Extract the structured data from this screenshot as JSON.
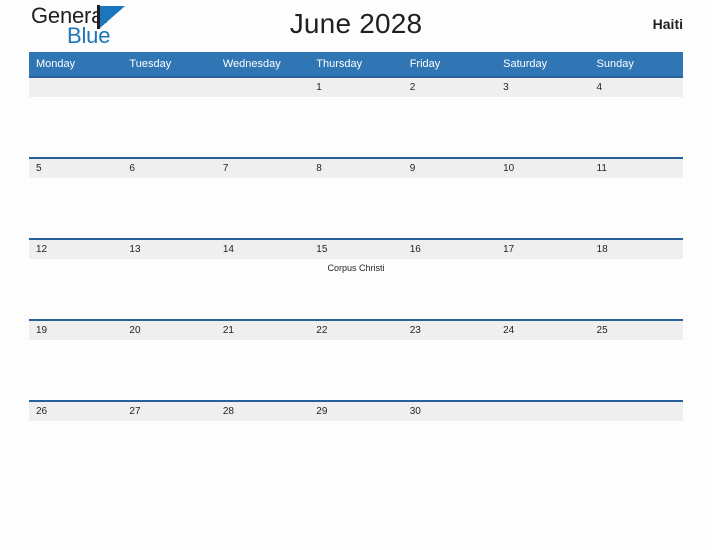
{
  "brand": {
    "name_part1": "General",
    "name_part2": "Blue",
    "mark": "triangle-logo-icon"
  },
  "header": {
    "title": "June 2028",
    "country": "Haiti"
  },
  "colors": {
    "header_blue": "#3075b4",
    "week_divider_blue": "#2a6099",
    "date_band_gray": "#efefef",
    "brand_blue": "#1b76bb",
    "text_dark": "#231f20",
    "page_background": "#fdfdfd"
  },
  "calendar": {
    "month": "June",
    "year": "2028",
    "weekday_headers": [
      "Monday",
      "Tuesday",
      "Wednesday",
      "Thursday",
      "Friday",
      "Saturday",
      "Sunday"
    ],
    "weeks": [
      {
        "days": [
          {
            "num": "",
            "events": []
          },
          {
            "num": "",
            "events": []
          },
          {
            "num": "",
            "events": []
          },
          {
            "num": "1",
            "events": []
          },
          {
            "num": "2",
            "events": []
          },
          {
            "num": "3",
            "events": []
          },
          {
            "num": "4",
            "events": []
          }
        ]
      },
      {
        "days": [
          {
            "num": "5",
            "events": []
          },
          {
            "num": "6",
            "events": []
          },
          {
            "num": "7",
            "events": []
          },
          {
            "num": "8",
            "events": []
          },
          {
            "num": "9",
            "events": []
          },
          {
            "num": "10",
            "events": []
          },
          {
            "num": "11",
            "events": []
          }
        ]
      },
      {
        "days": [
          {
            "num": "12",
            "events": []
          },
          {
            "num": "13",
            "events": []
          },
          {
            "num": "14",
            "events": []
          },
          {
            "num": "15",
            "events": [
              "Corpus Christi"
            ]
          },
          {
            "num": "16",
            "events": []
          },
          {
            "num": "17",
            "events": []
          },
          {
            "num": "18",
            "events": []
          }
        ]
      },
      {
        "days": [
          {
            "num": "19",
            "events": []
          },
          {
            "num": "20",
            "events": []
          },
          {
            "num": "21",
            "events": []
          },
          {
            "num": "22",
            "events": []
          },
          {
            "num": "23",
            "events": []
          },
          {
            "num": "24",
            "events": []
          },
          {
            "num": "25",
            "events": []
          }
        ]
      },
      {
        "days": [
          {
            "num": "26",
            "events": []
          },
          {
            "num": "27",
            "events": []
          },
          {
            "num": "28",
            "events": []
          },
          {
            "num": "29",
            "events": []
          },
          {
            "num": "30",
            "events": []
          },
          {
            "num": "",
            "events": []
          },
          {
            "num": "",
            "events": []
          }
        ]
      }
    ]
  }
}
